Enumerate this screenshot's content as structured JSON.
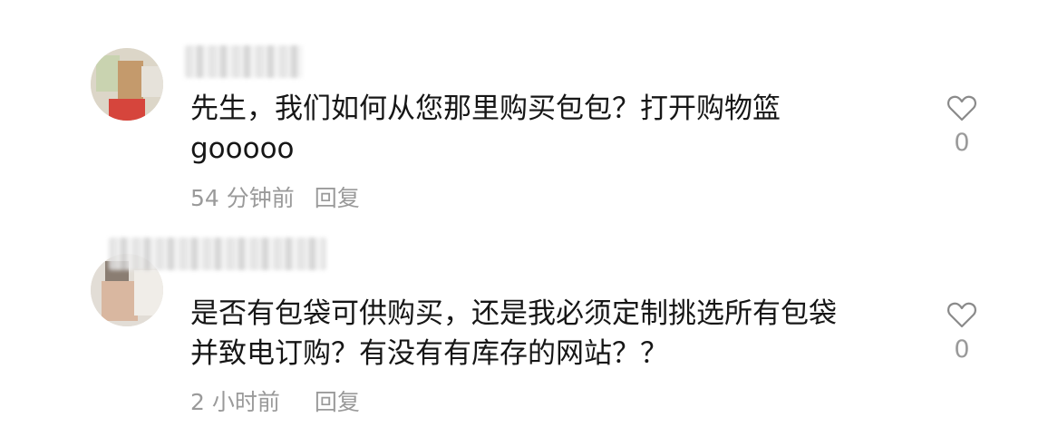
{
  "comments": [
    {
      "text_lines": [
        "先生，我们如何从您那里购买包包？打开购物篮",
        "gooooo"
      ],
      "time": "54 分钟前",
      "reply_label": "回复",
      "like_count": "0",
      "like_icon": "heart-outline-icon"
    },
    {
      "text_lines": [
        "是否有包袋可供购买，还是我必须定制挑选所有包袋",
        "并致电订购？有没有有库存的网站？？"
      ],
      "time": "2 小时前",
      "reply_label": "回复",
      "like_count": "0",
      "like_icon": "heart-outline-icon"
    }
  ]
}
